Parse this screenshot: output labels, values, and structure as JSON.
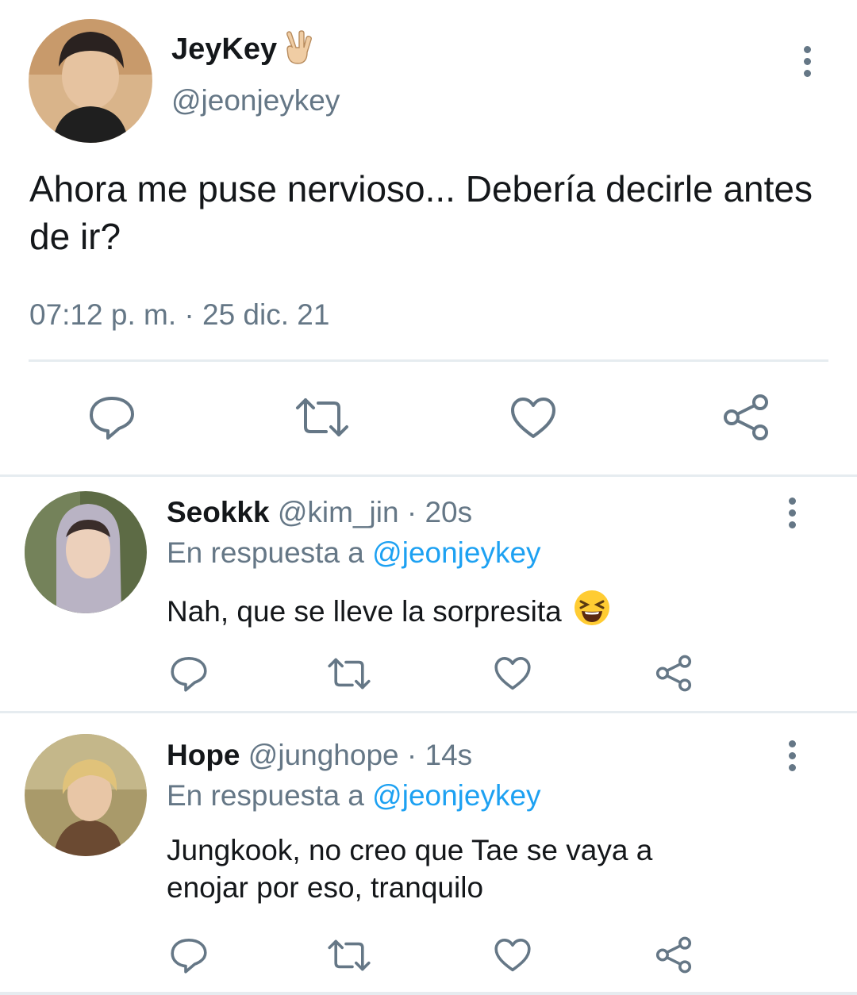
{
  "main_tweet": {
    "display_name": "JeyKey",
    "name_emoji": "victory-hand-emoji",
    "handle": "@jeonjeykey",
    "text": "Ahora me puse nervioso... Debería decirle antes de ir?",
    "timestamp": "07:12 p. m. · 25 dic. 21",
    "actions": [
      "reply-icon",
      "retweet-icon",
      "like-icon",
      "share-icon"
    ]
  },
  "replies": [
    {
      "display_name": "Seokkk",
      "handle": "@kim_jin",
      "age": "· 20s",
      "replying_prefix": "En respuesta a",
      "replying_to": "@jeonjeykey",
      "text": "Nah, que se lleve la sorpresita",
      "text_emoji": "laughing-face-emoji"
    },
    {
      "display_name": "Hope",
      "handle": "@junghope",
      "age": "· 14s",
      "replying_prefix": "En respuesta a",
      "replying_to": "@jeonjeykey",
      "text_line1": "Jungkook, no creo que Tae se vaya a",
      "text_line2": "enojar por eso, tranquilo"
    }
  ],
  "colors": {
    "text": "#14171a",
    "secondary": "#657786",
    "link": "#1da1f2",
    "divider": "#e6ecf0"
  }
}
